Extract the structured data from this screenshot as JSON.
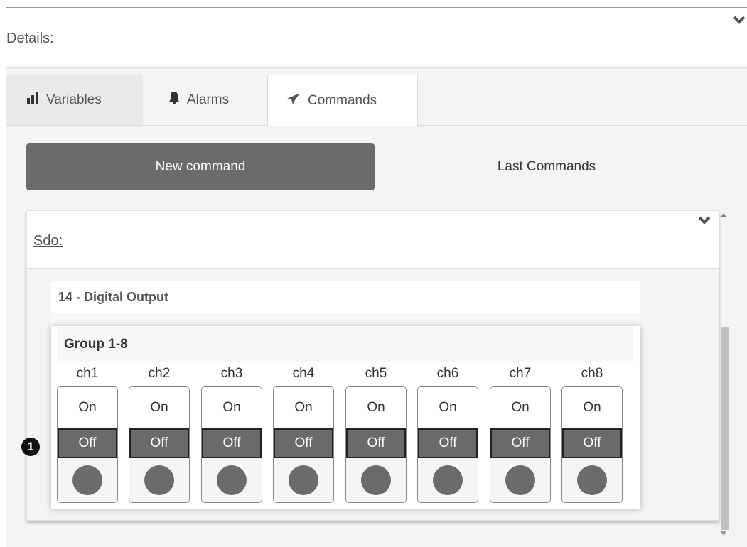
{
  "details": {
    "title": "Details:"
  },
  "tabs": [
    {
      "label": "Variables",
      "icon": "bar-chart-icon"
    },
    {
      "label": "Alarms",
      "icon": "bell-icon"
    },
    {
      "label": "Commands",
      "icon": "paper-plane-icon"
    }
  ],
  "subnav": {
    "new_command": "New command",
    "last_commands": "Last Commands"
  },
  "sdo": {
    "title": "Sdo:",
    "section_title": "14 - Digital Output",
    "group_title": "Group 1-8",
    "channels": [
      {
        "label": "ch1",
        "on": "On",
        "off": "Off"
      },
      {
        "label": "ch2",
        "on": "On",
        "off": "Off"
      },
      {
        "label": "ch3",
        "on": "On",
        "off": "Off"
      },
      {
        "label": "ch4",
        "on": "On",
        "off": "Off"
      },
      {
        "label": "ch5",
        "on": "On",
        "off": "Off"
      },
      {
        "label": "ch6",
        "on": "On",
        "off": "Off"
      },
      {
        "label": "ch7",
        "on": "On",
        "off": "Off"
      },
      {
        "label": "ch8",
        "on": "On",
        "off": "Off"
      }
    ]
  },
  "marker": {
    "label": "1"
  },
  "colors": {
    "button_dark": "#6b6b6b",
    "led_off": "#6b6b6b",
    "accent_border": "#222222"
  }
}
